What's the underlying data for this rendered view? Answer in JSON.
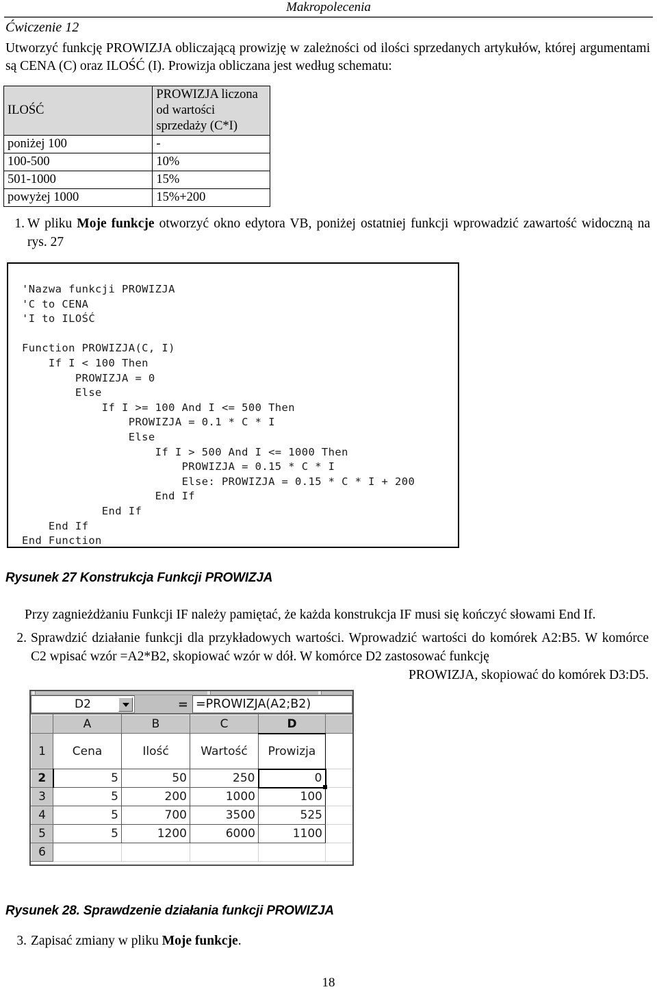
{
  "header": {
    "running_title": "Makropolecenia"
  },
  "exercise": {
    "title": "Ćwiczenie 12",
    "intro": "Utworzyć funkcję PROWIZJA obliczającą prowizję w zależności od ilości sprzedanych artykułów, której argumentami są CENA (C) oraz ILOŚĆ (I). Prowizja obliczana jest według schematu:"
  },
  "rates_table": {
    "headers": [
      "ILOŚĆ",
      "PROWIZJA liczona od wartości sprzedaży (C*I)"
    ],
    "rows": [
      [
        "poniżej 100",
        "-"
      ],
      [
        "100-500",
        "10%"
      ],
      [
        "501-1000",
        "15%"
      ],
      [
        "powyżej 1000",
        "15%+200"
      ]
    ]
  },
  "steps": {
    "item1": {
      "number": "1.",
      "text_before": "W pliku ",
      "bold": "Moje funkcje",
      "text_after": " otworzyć okno edytora VB, poniżej ostatniej funkcji wprowadzić zawartość widoczną na rys. 27"
    },
    "item2": {
      "number": "2.",
      "text": "Sprawdzić działanie funkcji dla przykładowych wartości. Wprowadzić wartości do komórek A2:B5. W komórce C2 wpisać wzór =A2*B2, skopiować wzór w dół. W komórce D2 zastosować funkcję",
      "last_line": "PROWIZJA, skopiować do komórek D3:D5."
    },
    "item3": {
      "number": "3.",
      "text_before": "Zapisać zmiany w pliku ",
      "bold": "Moje funkcje",
      "text_after": "."
    }
  },
  "code_figure": {
    "code": "'Nazwa funkcji PROWIZJA\n'C to CENA\n'I to ILOŚĆ\n\nFunction PROWIZJA(C, I)\n    If I < 100 Then\n        PROWIZJA = 0\n        Else\n            If I >= 100 And I <= 500 Then\n                PROWIZJA = 0.1 * C * I\n                Else\n                    If I > 500 And I <= 1000 Then\n                        PROWIZJA = 0.15 * C * I\n                        Else: PROWIZJA = 0.15 * C * I + 200\n                    End If\n            End If\n    End If\nEnd Function"
  },
  "captions": {
    "figure27": "Rysunek 27 Konstrukcja Funkcji PROWIZJA",
    "figure28": "Rysunek 28. Sprawdzenie działania funkcji PROWIZJA"
  },
  "note": "Przy zagnieżdżaniu Funkcji IF należy pamiętać, że każda konstrukcja IF musi się kończyć słowami End If.",
  "excel": {
    "name_box": "D2",
    "equals_label": "=",
    "formula": "=PROWIZJA(A2;B2)",
    "column_headers": [
      "A",
      "B",
      "C",
      "D"
    ],
    "active_column": "D",
    "active_row": "2",
    "row_headers": [
      "1",
      "2",
      "3",
      "4",
      "5",
      "6"
    ],
    "header_row": [
      "Cena",
      "Ilość",
      "Wartość",
      "Prowizja"
    ],
    "data_rows": [
      {
        "row": "2",
        "cells": [
          "5",
          "50",
          "250",
          "0"
        ]
      },
      {
        "row": "3",
        "cells": [
          "5",
          "200",
          "1000",
          "100"
        ]
      },
      {
        "row": "4",
        "cells": [
          "5",
          "700",
          "3500",
          "525"
        ]
      },
      {
        "row": "5",
        "cells": [
          "5",
          "1200",
          "6000",
          "1100"
        ]
      }
    ]
  },
  "page_number": "18"
}
